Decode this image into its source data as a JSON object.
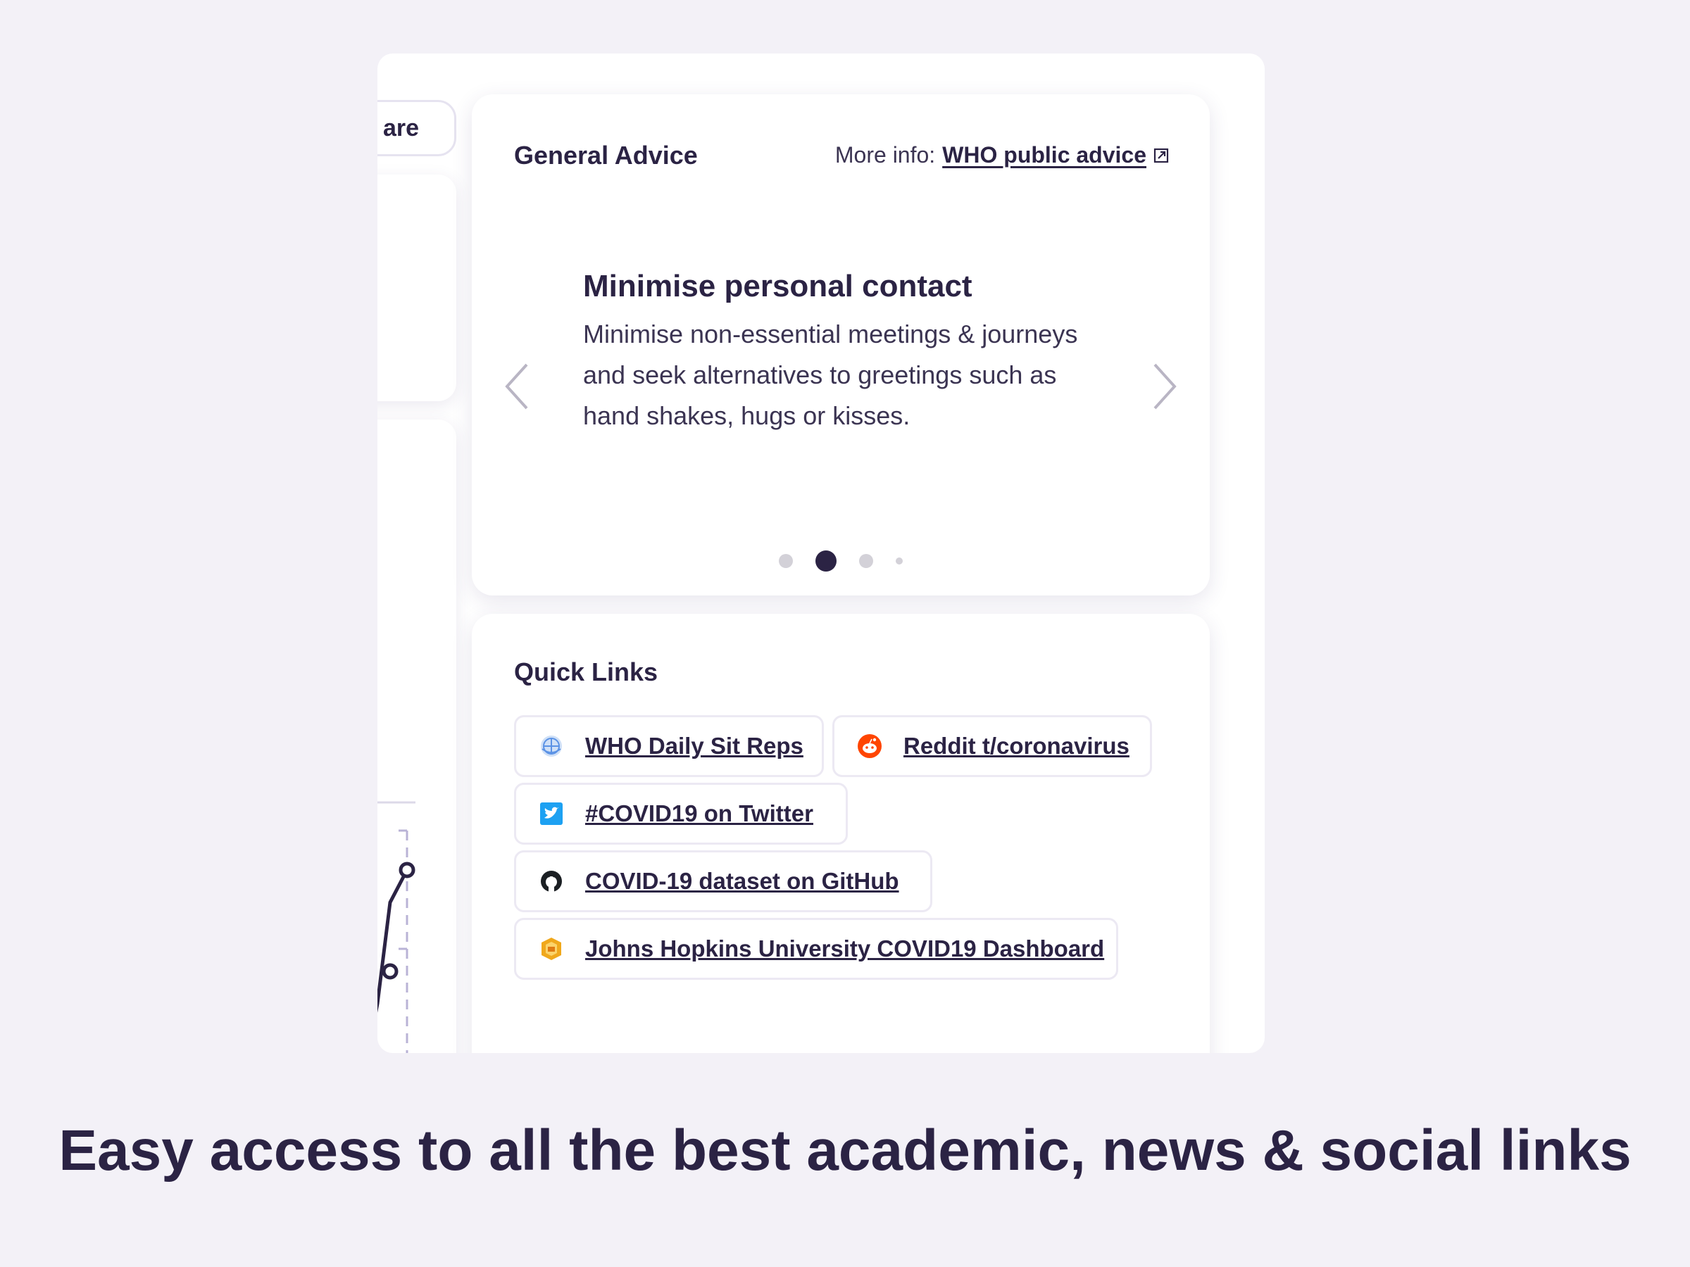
{
  "left_column": {
    "share_label": "are"
  },
  "advice": {
    "title": "General Advice",
    "more_info_label": "More info:",
    "more_info_link": "WHO public advice",
    "heading": "Minimise personal contact",
    "body": "Minimise non-essential meetings & journeys and seek alternatives to greetings such as hand shakes, hugs or kisses.",
    "slide_count": 4,
    "active_slide": 2
  },
  "quick_links": {
    "title": "Quick Links",
    "links": [
      {
        "label": "WHO Daily Sit Reps",
        "icon": "who-icon"
      },
      {
        "label": "Reddit t/coronavirus",
        "icon": "reddit-icon"
      },
      {
        "label": "#COVID19 on Twitter",
        "icon": "twitter-icon"
      },
      {
        "label": "COVID-19 dataset on GitHub",
        "icon": "github-icon"
      },
      {
        "label": "Johns Hopkins University COVID19 Dashboard",
        "icon": "jhu-dashboard-icon"
      }
    ]
  },
  "colors": {
    "background": "#f3f1f7",
    "text": "#2b2344",
    "reddit": "#ff4500",
    "twitter": "#1da1f2",
    "who": "#5b92e5",
    "jhu": "#f0a81c"
  },
  "caption": "Easy access to all the best academic, news & social links"
}
